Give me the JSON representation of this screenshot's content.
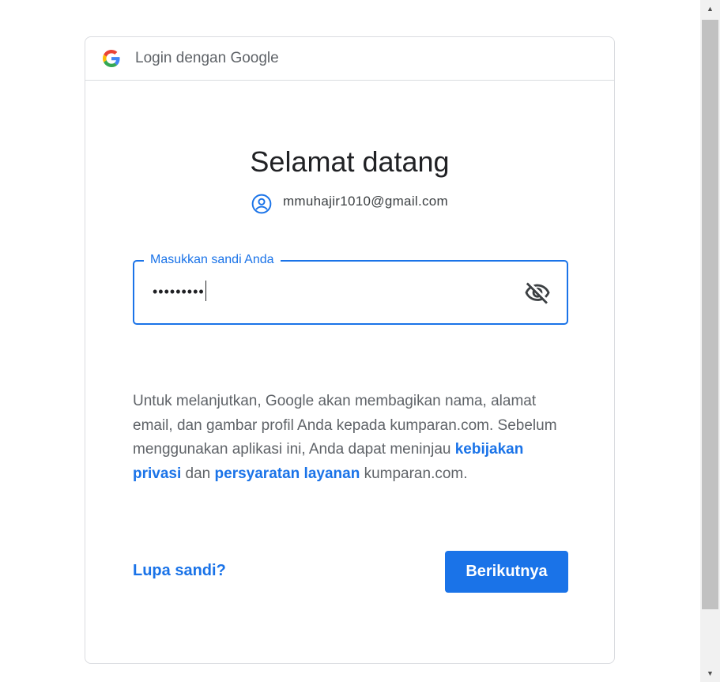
{
  "header": {
    "logo_icon": "google-g-icon",
    "title": "Login dengan Google"
  },
  "main": {
    "title": "Selamat datang",
    "account_icon": "account-circle-icon",
    "account_email": "mmuhajir1010@gmail.com"
  },
  "password": {
    "label": "Masukkan sandi Anda",
    "value": "•••••••••",
    "toggle_icon": "eye-off-icon"
  },
  "info": {
    "text_1": "Untuk melanjutkan, Google akan membagikan nama, alamat email, dan gambar profil Anda kepada kumparan.com. Sebelum menggunakan aplikasi ini, Anda dapat meninjau ",
    "privacy_link": "kebijakan privasi",
    "text_2": " dan ",
    "terms_link": "persyaratan layanan",
    "text_3": " kumparan.com."
  },
  "actions": {
    "forgot_label": "Lupa sandi?",
    "next_label": "Berikutnya"
  },
  "colors": {
    "accent": "#1a73e8",
    "text_primary": "#202124",
    "text_secondary": "#5f6368",
    "border": "#dadce0"
  }
}
